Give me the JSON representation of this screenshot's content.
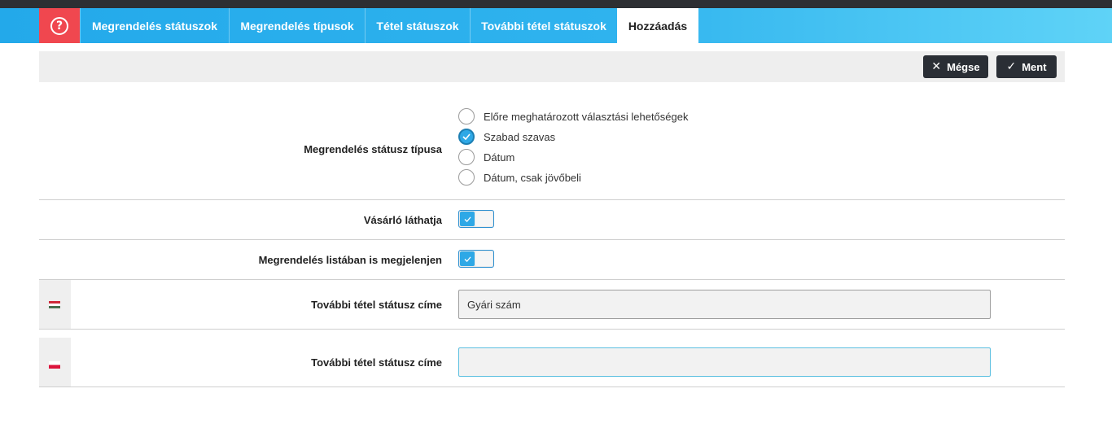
{
  "tabs": [
    {
      "label": "Megrendelés státuszok",
      "active": false
    },
    {
      "label": "Megrendelés típusok",
      "active": false
    },
    {
      "label": "Tétel státuszok",
      "active": false
    },
    {
      "label": "További tétel státuszok",
      "active": false
    },
    {
      "label": "Hozzáadás",
      "active": true
    }
  ],
  "help_icon": "question-circle-icon",
  "toolbar": {
    "cancel_label": "Mégse",
    "save_label": "Ment",
    "cancel_icon": "close-icon",
    "save_icon": "check-icon"
  },
  "form": {
    "status_type": {
      "label": "Megrendelés státusz típusa",
      "options": [
        {
          "label": "Előre meghatározott választási lehetőségek",
          "checked": false
        },
        {
          "label": "Szabad szavas",
          "checked": true
        },
        {
          "label": "Dátum",
          "checked": false
        },
        {
          "label": "Dátum, csak jövőbeli",
          "checked": false
        }
      ]
    },
    "customer_visible": {
      "label": "Vásárló láthatja",
      "value": true
    },
    "show_in_list": {
      "label": "Megrendelés listában is megjelenjen",
      "value": true
    },
    "title_hu": {
      "label": "További tétel státusz címe",
      "value": "Gyári szám",
      "flag": "hungarian-flag-icon"
    },
    "title_pl": {
      "label": "További tétel státusz címe",
      "value": "",
      "flag": "polish-flag-icon"
    }
  },
  "colors": {
    "tabbar": "#2fb3ee",
    "help": "#f0474f",
    "button_dark": "#2a2e35",
    "accent": "#2ea8e6"
  }
}
